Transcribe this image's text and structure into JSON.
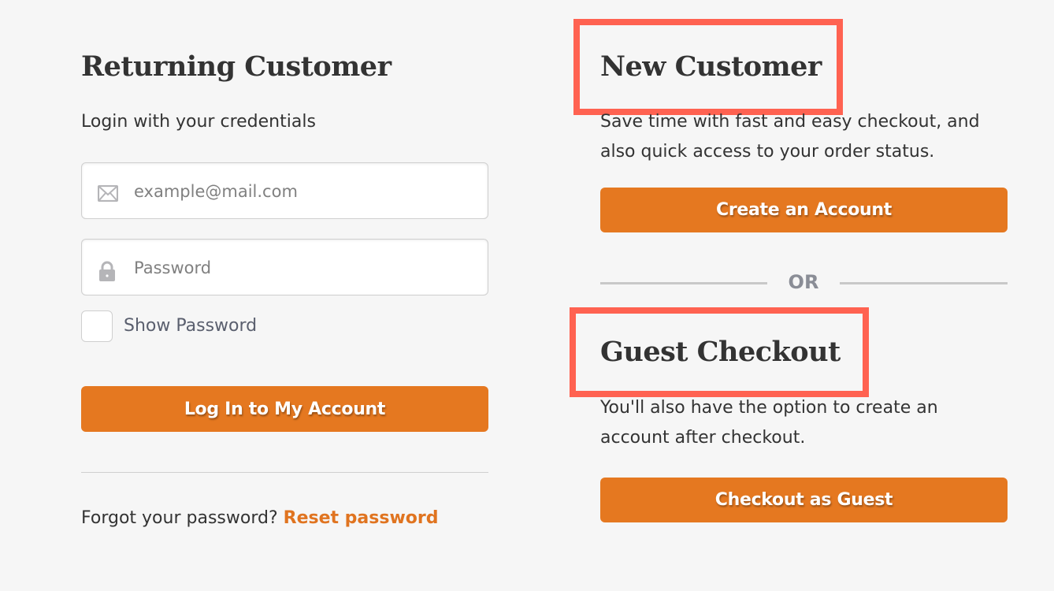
{
  "returning": {
    "title": "Returning Customer",
    "subtitle": "Login with your credentials",
    "email": {
      "placeholder": "example@mail.com",
      "value": "",
      "icon": "envelope-icon"
    },
    "password": {
      "placeholder": "Password",
      "value": "",
      "icon": "lock-icon"
    },
    "show_password": {
      "label": "Show Password",
      "checked": false
    },
    "login_button": "Log In to My Account",
    "forgot_text": "Forgot your password?",
    "reset_link": "Reset password"
  },
  "new_customer": {
    "title": "New Customer",
    "description": "Save time with fast and easy checkout, and also quick access to your order status.",
    "create_button": "Create an Account"
  },
  "separator": {
    "label": "OR"
  },
  "guest": {
    "title": "Guest Checkout",
    "description": "You'll also have the option to create an account after checkout.",
    "guest_button": "Checkout as Guest"
  },
  "colors": {
    "accent": "#e57820",
    "link": "#e07420",
    "highlight": "#ff6251",
    "background": "#f6f6f6"
  }
}
